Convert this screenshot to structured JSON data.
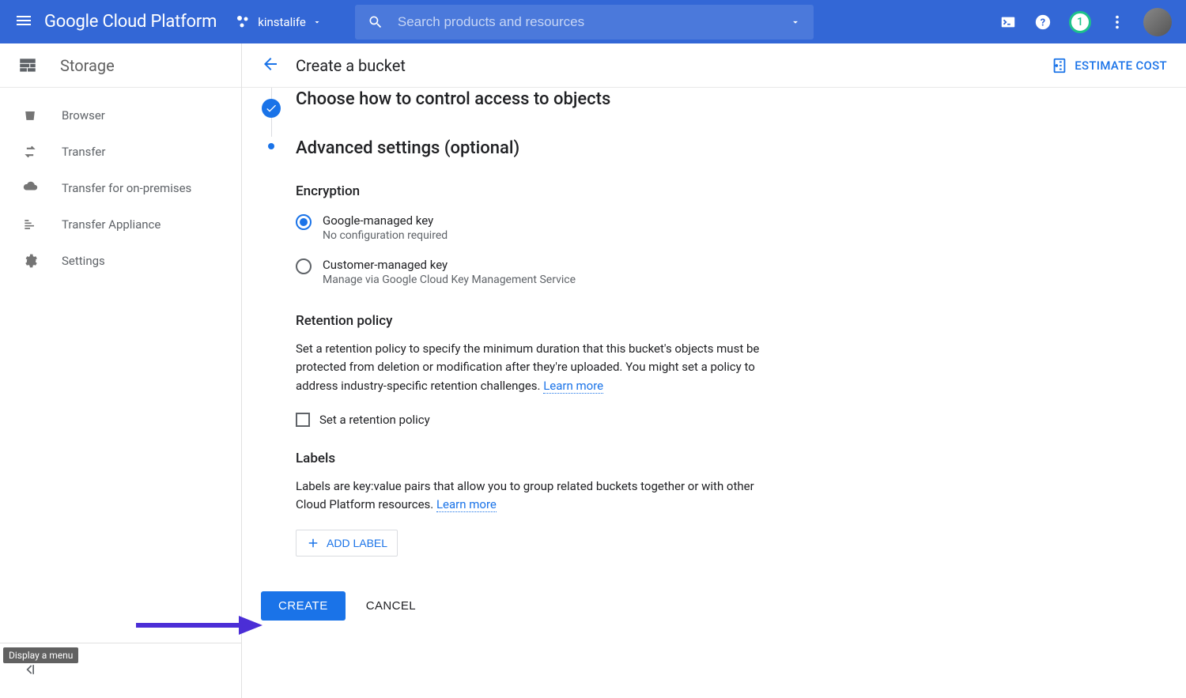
{
  "header": {
    "product": "Google Cloud Platform",
    "project": "kinstalife",
    "search_placeholder": "Search products and resources",
    "badge_count": "1"
  },
  "sidebar": {
    "title": "Storage",
    "items": [
      {
        "label": "Browser"
      },
      {
        "label": "Transfer"
      },
      {
        "label": "Transfer for on-premises"
      },
      {
        "label": "Transfer Appliance"
      },
      {
        "label": "Settings"
      }
    ],
    "tooltip": "Display a menu"
  },
  "page": {
    "title": "Create a bucket",
    "estimate_label": "ESTIMATE COST"
  },
  "steps": {
    "access": {
      "title": "Choose how to control access to objects"
    },
    "advanced": {
      "title": "Advanced settings (optional)",
      "encryption": {
        "heading": "Encryption",
        "google": {
          "label": "Google-managed key",
          "sub": "No configuration required"
        },
        "customer": {
          "label": "Customer-managed key",
          "sub": "Manage via Google Cloud Key Management Service"
        }
      },
      "retention": {
        "heading": "Retention policy",
        "desc": "Set a retention policy to specify the minimum duration that this bucket's objects must be protected from deletion or modification after they're uploaded. You might set a policy to address industry-specific retention challenges. ",
        "learn": "Learn more",
        "checkbox": "Set a retention policy"
      },
      "labels": {
        "heading": "Labels",
        "desc": "Labels are key:value pairs that allow you to group related buckets together or with other Cloud Platform resources. ",
        "learn": "Learn more",
        "add_btn": "ADD LABEL"
      }
    }
  },
  "actions": {
    "create": "CREATE",
    "cancel": "CANCEL"
  }
}
